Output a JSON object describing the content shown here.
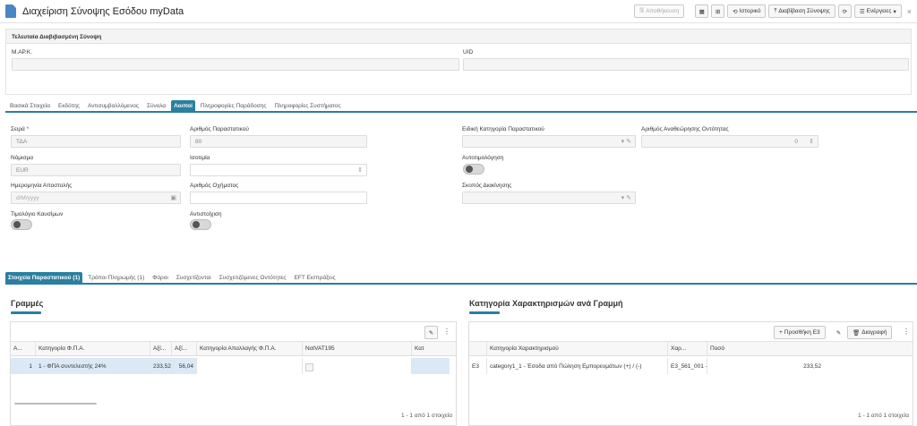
{
  "window": {
    "title": "Διαχείριση Σύνοψης Εσόδου myData"
  },
  "toolbar": {
    "save_label": "Αποθήκευση",
    "history_label": "Ιστορικό",
    "read_summary_label": "Διαβίβαση Σύνοψης",
    "actions_label": "Ενέργειες"
  },
  "last_submitted": {
    "header": "Τελευταία Διαβιβασμένη Σύνοψη",
    "mark_label": "Μ.ΑΡ.Κ.",
    "uid_label": "UID"
  },
  "main_tabs": [
    "Βασικά Στοιχεία",
    "Εκδότης",
    "Αντισυμβαλλόμενος",
    "Σύνολα",
    "Λοιποί",
    "Πληροφορίες Παράδοσης",
    "Πληροφορίες Συστήματος"
  ],
  "main_tab_active": 4,
  "form": {
    "series_label": "Σειρά",
    "series_required": "*",
    "series_value": "ΤΔΑ",
    "doc_number_label": "Αριθμός Παραστατικού",
    "doc_number_value": "80",
    "special_category_label": "Ειδική Κατηγορία Παραστατικού",
    "revision_label": "Αριθμός Αναθεώρησης Οντότητας",
    "revision_value": "0",
    "currency_label": "Νόμισμα",
    "currency_value": "EUR",
    "rate_label": "Ισοτιμία",
    "self_pricing_label": "Αυτοτιμολόγηση",
    "dispatch_date_label": "Ημερομηνία Αποστολής",
    "dispatch_date_placeholder": "d/M/yyyy",
    "vehicle_label": "Αριθμός Οχήματος",
    "movement_purpose_label": "Σκοπός Διακίνησης",
    "fuel_invoice_label": "Τιμολόγιο Καυσίμων",
    "correlation_label": "Αντιστοίχιση"
  },
  "sub_tabs": [
    "Στοιχεία Παραστατικού (1)",
    "Τρόποι Πληρωμής (1)",
    "Φόροι",
    "Συσχετίζονται",
    "Συσχετιζόμενες Οντότητες",
    "EFT Εισπράξεις"
  ],
  "sub_tab_active": 0,
  "lines": {
    "title": "Γραμμές",
    "columns": [
      "Α...",
      "Κατηγορία Φ.Π.Α.",
      "Αξί...",
      "Αξί...",
      "Κατηγορία Απαλλαγής Φ.Π.Α.",
      "NotVAT195",
      "Κατ"
    ],
    "rows": [
      [
        "1",
        "1 - ΦΠΑ συντελεστής 24%",
        "233,52",
        "56,04",
        "",
        "",
        ""
      ]
    ],
    "footer": "1 - 1 από 1 στοιχεία"
  },
  "classifications": {
    "title": "Κατηγορία Χαρακτηρισμών ανά Γραμμή",
    "add_label": "Προσθήκη Ε3",
    "delete_label": "Διαγραφή",
    "columns": [
      "",
      "Κατηγορία Χαρακτηρισμού",
      "Χαρ...",
      "Ποσό"
    ],
    "rows": [
      [
        "E3",
        "category1_1 - Έσοδα από Πώληση Εμπορευμάτων (+) / (-)",
        "E3_561_001 -",
        "233,52"
      ]
    ],
    "footer": "1 - 1 από 1 στοιχεία"
  },
  "colors": {
    "accent": "#2b7fa0",
    "selected_row": "#dbe9f7"
  }
}
